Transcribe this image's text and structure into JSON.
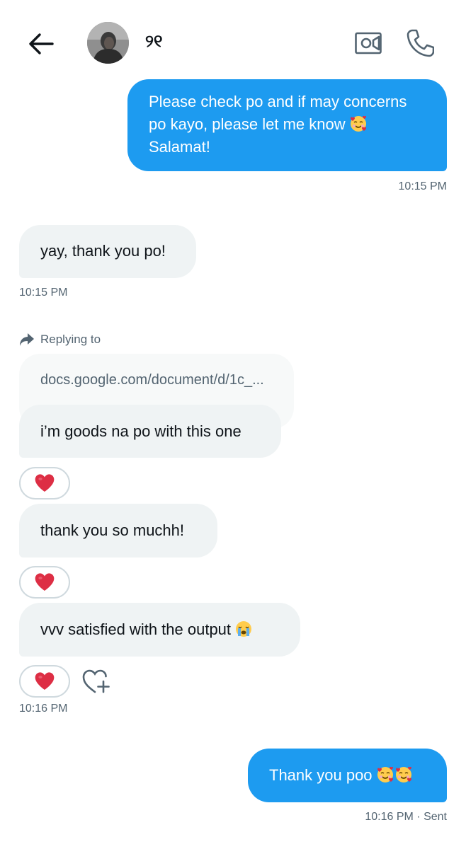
{
  "header": {
    "contact_name": "୨୧",
    "back_icon": "arrow-left-icon",
    "video_icon": "video-camera-icon",
    "call_icon": "phone-icon"
  },
  "messages": [
    {
      "direction": "sent",
      "lines": [
        "Please check po and if may concerns",
        "po kayo, please let me know",
        "Salamat!"
      ],
      "emoji": "smiling-face-with-hearts",
      "time": "10:15 PM"
    },
    {
      "direction": "received",
      "text": "yay, thank you po!",
      "time": "10:15 PM"
    },
    {
      "direction": "received",
      "replying_label": "Replying to",
      "quoted": "docs.google.com/document/d/1c_...",
      "text": "i’m goods na po with this one",
      "reaction": "heart"
    },
    {
      "direction": "received",
      "text": "thank you so muchh!",
      "reaction": "heart"
    },
    {
      "direction": "received",
      "text": "vvv satisfied with the output",
      "emoji": "loudly-crying-face",
      "reaction": "heart",
      "time": "10:16 PM"
    },
    {
      "direction": "sent",
      "text": "Thank you poo",
      "emoji": "smiling-face-with-hearts",
      "time": "10:16 PM · Sent"
    }
  ],
  "colors": {
    "sent_bubble": "#1d9bf0",
    "received_bubble": "#eff3f4",
    "secondary_text": "#536471",
    "heart": "#f4212e"
  }
}
